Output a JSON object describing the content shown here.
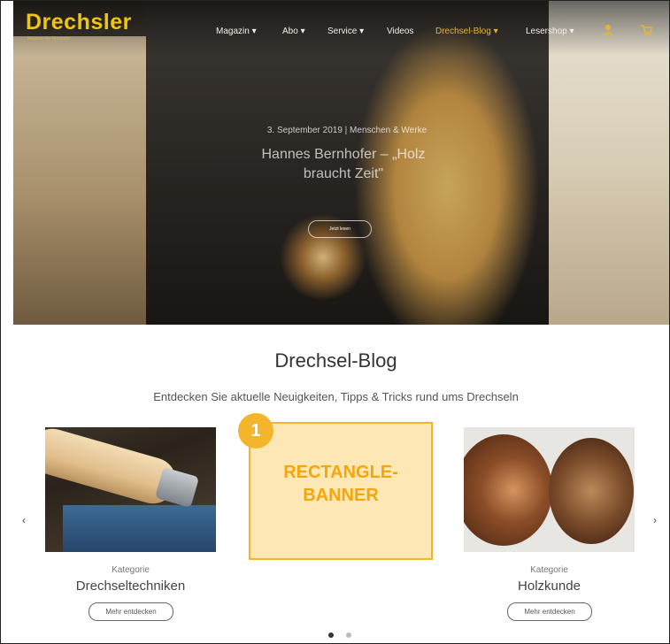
{
  "nav": {
    "logo": "Drechsler",
    "logo_sub": "Magazin für Drechsler",
    "items": [
      "Magazin",
      "Abo",
      "Service",
      "Videos",
      "Drechsel-Blog",
      "Lesershop"
    ],
    "active_index": 4,
    "accent_color": "#e5b531"
  },
  "hero": {
    "date": "3. September 2019 | Menschen & Werke",
    "title": "Hannes Bernhofer – „Holz braucht Zeit\"",
    "button": "Jetzt lesen"
  },
  "section": {
    "title": "Drechsel-Blog",
    "subtitle": "Entdecken Sie aktuelle Neuigkeiten, Tipps & Tricks rund ums Drechseln"
  },
  "carousel": {
    "prev": "‹",
    "next": "›",
    "dots_total": 2,
    "dots_active": 0
  },
  "cards": [
    {
      "label": "Kategorie",
      "name": "Drechseltechniken",
      "button": "Mehr entdecken"
    },
    {
      "label": "Kategorie",
      "name": "Holzkunde",
      "button": "Mehr entdecken"
    }
  ],
  "banner": {
    "badge": "1",
    "line1": "RECTANGLE-",
    "line2": "BANNER",
    "color": "#f2b52c"
  }
}
